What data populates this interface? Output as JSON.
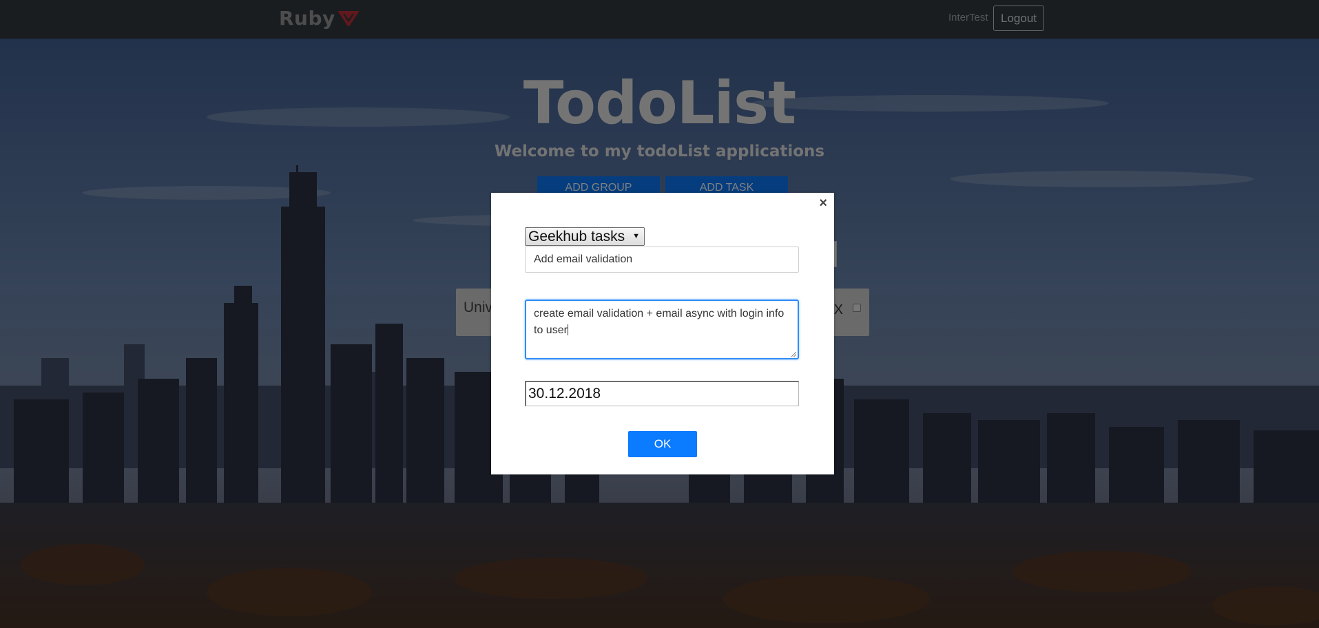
{
  "navbar": {
    "logo_text": "Ruby",
    "user_name": "InterTest",
    "logout_label": "Logout"
  },
  "hero": {
    "title": "TodoList",
    "subtitle": "Welcome to my todoList applications",
    "add_group_label": "ADD GROUP",
    "add_task_label": "ADD TASK"
  },
  "group_card": {
    "name": "Univ",
    "delete_label": "X"
  },
  "modal": {
    "close_label": "×",
    "group_select_value": "Geekhub tasks",
    "group_select_arrow": "▼",
    "title_value": "Add email validation",
    "description_value": "create email validation + email async with login info to user",
    "date_value": "30.12.2018",
    "ok_label": "OK"
  },
  "colors": {
    "accent": "#0b7bff",
    "navbar": "#343a40",
    "focus_border": "#2f8bf5"
  }
}
